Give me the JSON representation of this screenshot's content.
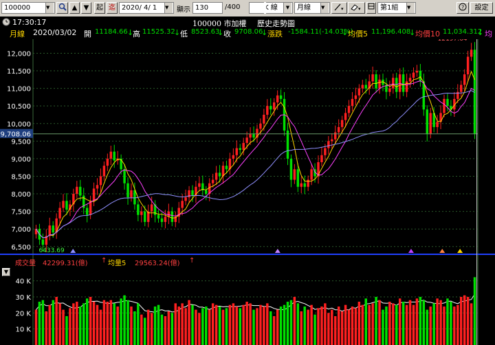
{
  "toolbar": {
    "symbol": "100000",
    "start_label": "起",
    "end_label": "迄",
    "date": "2020/ 4/ 1",
    "display_label": "顯示",
    "display_count": "130",
    "total": "/400",
    "chart_type": "K 線",
    "period": "月線",
    "group": "第1組",
    "settings_label": "設定"
  },
  "header": {
    "time": "17:30:17",
    "title": "100000 市加權",
    "subtitle": "歷史走勢圖"
  },
  "info": {
    "period": "月線",
    "date": "2020/03/02",
    "open_label": "開",
    "open": "11184.66",
    "high_label": "高",
    "high": "11525.32",
    "low_label": "低",
    "low": "8523.63",
    "close_label": "收",
    "close": "9708.06",
    "change_label": "漲跌",
    "change": "-1584.11(-14.03%)",
    "ma5_label": "均價5",
    "ma5": "11,196.408",
    "ma10_label": "均價10",
    "ma10": "11,034.312",
    "ma20_label": "均"
  },
  "volume_info": {
    "label": "成交量",
    "value": "42299.31(億)",
    "ma_label": "均量5",
    "ma_value": "29563.24(億)"
  },
  "annotations": {
    "max": "12197.64",
    "min": "6433.69",
    "current": "9,708.06"
  },
  "colors": {
    "up": "#ff2020",
    "down": "#00e000",
    "ma5": "#ffd700",
    "ma10": "#ff40ff",
    "ma20": "#9090ff",
    "grid": "#2a5a2a"
  },
  "chart_data": {
    "type": "candlestick",
    "price_axis": {
      "ylim": [
        6300,
        12400
      ],
      "ticks": [
        6500,
        7000,
        7500,
        8000,
        8500,
        9000,
        9500,
        10000,
        10500,
        11000,
        11500,
        12000
      ]
    },
    "volume_axis": {
      "ylim": [
        0,
        45000
      ],
      "ticks": [
        10000,
        20000,
        30000,
        40000
      ],
      "tick_labels": [
        "10 K",
        "20 K",
        "30 K",
        "40 K"
      ]
    },
    "series": [
      {
        "name": "均價5",
        "source": "ma5"
      },
      {
        "name": "均價10",
        "source": "ma10"
      }
    ],
    "close": [
      7000,
      6700,
      6550,
      6800,
      7100,
      6900,
      7300,
      7600,
      7800,
      7550,
      7700,
      8000,
      8200,
      7950,
      7600,
      7400,
      7800,
      8150,
      8250,
      8500,
      8800,
      9000,
      9200,
      8950,
      9000,
      8700,
      8300,
      7900,
      8100,
      7700,
      7400,
      7500,
      7200,
      7500,
      7700,
      7400,
      7300,
      7200,
      7350,
      7500,
      7200,
      7350,
      7600,
      7800,
      7900,
      8100,
      7950,
      8200,
      8300,
      8100,
      8000,
      8300,
      8400,
      8600,
      8500,
      8800,
      8700,
      9000,
      9100,
      9300,
      9250,
      9450,
      9600,
      9700,
      9600,
      9850,
      10000,
      10250,
      10500,
      10400,
      10600,
      10800,
      10700,
      9800,
      9000,
      8400,
      8700,
      8200,
      8300,
      8200,
      8400,
      8700,
      8500,
      8900,
      9100,
      9300,
      9500,
      9550,
      9750,
      9900,
      10100,
      10300,
      10500,
      10700,
      10800,
      11000,
      11100,
      11000,
      11200,
      11400,
      11000,
      11250,
      11100,
      10900,
      11000,
      11300,
      10900,
      11400,
      10900,
      11200,
      11300,
      11450,
      11500,
      11200,
      10400,
      9700,
      10300,
      9900,
      10050,
      10300,
      10700,
      10500,
      10400,
      10700,
      10900,
      11100,
      11400,
      11900,
      12100,
      9708
    ],
    "volume": [
      22000,
      27000,
      28000,
      21000,
      25000,
      28000,
      30000,
      26000,
      22000,
      18000,
      23000,
      26000,
      27000,
      24000,
      26000,
      29000,
      30000,
      27000,
      25000,
      22000,
      28000,
      27000,
      28000,
      26000,
      24000,
      29000,
      31000,
      28000,
      24000,
      21000,
      26000,
      19000,
      17000,
      22000,
      20000,
      24000,
      25000,
      19000,
      18000,
      21000,
      20000,
      26000,
      24000,
      26000,
      23000,
      28000,
      25000,
      22000,
      20000,
      23000,
      24000,
      22000,
      26000,
      25000,
      24000,
      22000,
      23000,
      25000,
      26000,
      24000,
      23000,
      25000,
      27000,
      26000,
      22000,
      23000,
      25000,
      24000,
      26000,
      21000,
      18000,
      22000,
      24000,
      25000,
      27000,
      28000,
      30000,
      26000,
      21000,
      24000,
      22000,
      25000,
      19000,
      23000,
      24000,
      26000,
      20000,
      22000,
      18000,
      24000,
      21000,
      25000,
      22000,
      24000,
      23000,
      27000,
      25000,
      29000,
      25000,
      26000,
      30000,
      28000,
      22000,
      24000,
      27000,
      26000,
      25000,
      29000,
      27000,
      25000,
      28000,
      25000,
      29000,
      30000,
      28000,
      22000,
      24000,
      26000,
      29000,
      28000,
      24000,
      29000,
      27000,
      24000,
      25000,
      30000,
      31000,
      30000,
      26000,
      42299
    ]
  }
}
